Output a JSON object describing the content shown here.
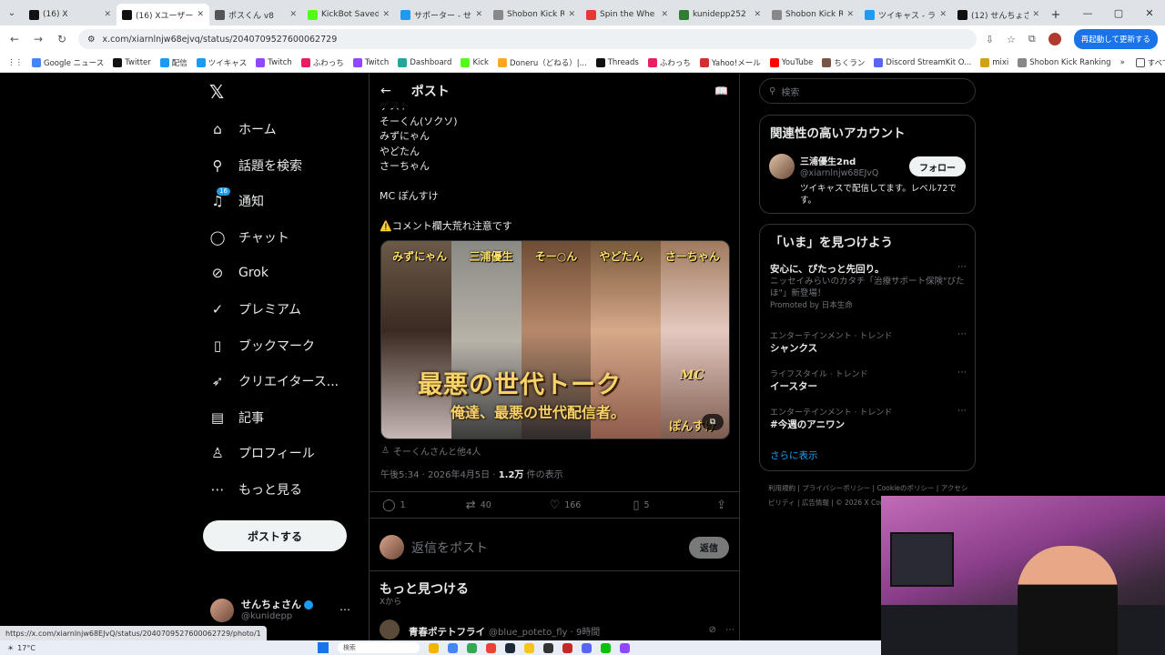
{
  "browser": {
    "tabs": [
      {
        "title": "(16) X",
        "fav_color": "#111111",
        "active": false
      },
      {
        "title": "(16) Xユーザーの",
        "fav_color": "#111111",
        "active": true
      },
      {
        "title": "ポスくん v8",
        "fav_color": "#555555",
        "active": false
      },
      {
        "title": "KickBot Saved",
        "fav_color": "#53fc18",
        "active": false
      },
      {
        "title": "サポーター - せん",
        "fav_color": "#1d9bf0",
        "active": false
      },
      {
        "title": "Shobon Kick R",
        "fav_color": "#888888",
        "active": false
      },
      {
        "title": "Spin the Whe",
        "fav_color": "#e53935",
        "active": false
      },
      {
        "title": "kunidepp252",
        "fav_color": "#2e7d32",
        "active": false
      },
      {
        "title": "Shobon Kick R",
        "fav_color": "#888888",
        "active": false
      },
      {
        "title": "ツイキャス - ライブ",
        "fav_color": "#1d9bf0",
        "active": false
      },
      {
        "title": "(12) せんちょさん",
        "fav_color": "#111111",
        "active": false
      }
    ],
    "url": "x.com/xiarnlnjw68ejvq/status/2040709527600062729",
    "restart_label": "再起動して更新する",
    "bookmarks": [
      {
        "label": "Google ニュース",
        "color": "#4285f4"
      },
      {
        "label": "Twitter",
        "color": "#111111"
      },
      {
        "label": "配信",
        "color": "#1d9bf0"
      },
      {
        "label": "ツイキャス",
        "color": "#1d9bf0"
      },
      {
        "label": "Twitch",
        "color": "#9146ff"
      },
      {
        "label": "ふわっち",
        "color": "#e91e63"
      },
      {
        "label": "Twitch",
        "color": "#9146ff"
      },
      {
        "label": "Dashboard",
        "color": "#26a69a"
      },
      {
        "label": "Kick",
        "color": "#53fc18"
      },
      {
        "label": "Doneru（どねる）|...",
        "color": "#f9a825"
      },
      {
        "label": "Threads",
        "color": "#111111"
      },
      {
        "label": "ふわっち",
        "color": "#e91e63"
      },
      {
        "label": "Yahoo!メール",
        "color": "#d32f2f"
      },
      {
        "label": "YouTube",
        "color": "#ff0000"
      },
      {
        "label": "ちくラン",
        "color": "#795548"
      },
      {
        "label": "Discord StreamKit O...",
        "color": "#5865f2"
      },
      {
        "label": "mixi",
        "color": "#d4a017"
      },
      {
        "label": "Shobon Kick Ranking",
        "color": "#888888"
      }
    ],
    "all_bookmarks": "すべてのブック",
    "status_url": "https://x.com/xiarnlnjw68EJvQ/status/2040709527600062729/photo/1"
  },
  "nav": {
    "items": [
      {
        "label": "ホーム",
        "icon": "home-icon",
        "glyph": "⌂"
      },
      {
        "label": "話題を検索",
        "icon": "search-icon",
        "glyph": "⚲"
      },
      {
        "label": "通知",
        "icon": "bell-icon",
        "glyph": "♫",
        "badge": "16"
      },
      {
        "label": "チャット",
        "icon": "chat-icon",
        "glyph": "◯"
      },
      {
        "label": "Grok",
        "icon": "grok-icon",
        "glyph": "⊘"
      },
      {
        "label": "プレミアム",
        "icon": "premium-icon",
        "glyph": "✓"
      },
      {
        "label": "ブックマーク",
        "icon": "bookmark-icon",
        "glyph": "▯"
      },
      {
        "label": "クリエイタース...",
        "icon": "rocket-icon",
        "glyph": "➶"
      },
      {
        "label": "記事",
        "icon": "article-icon",
        "glyph": "▤"
      },
      {
        "label": "プロフィール",
        "icon": "profile-icon",
        "glyph": "♙"
      },
      {
        "label": "もっと見る",
        "icon": "more-icon",
        "glyph": "⋯"
      }
    ],
    "post_button": "ポストする",
    "account_name": "せんちょさん",
    "account_handle": "@kunidepp"
  },
  "main": {
    "header_title": "ポスト",
    "text_lines": [
      "ゲスト",
      "そーくん(ソクソ)",
      "みずにゃん",
      "やどたん",
      "さーちゃん",
      "",
      "MC ぽんすけ",
      "",
      "⚠️コメント欄大荒れ注意です"
    ],
    "media": {
      "names": [
        "みずにゃん",
        "三浦優生",
        "そー○ん",
        "やどたん",
        "さーちゃん"
      ],
      "title": "最悪の世代トーク",
      "subtitle": "俺達、最悪の世代配信者。",
      "mc": "MC",
      "mc_name": "ぽんすけ"
    },
    "tagged": "そーくんさんと他4人",
    "time": "午後5:34 · 2026年4月5日 · ",
    "views_count": "1.2万",
    "views_label": " 件の表示",
    "actions": {
      "replies": "1",
      "reposts": "40",
      "likes": "166",
      "bookmarks": "5"
    },
    "reply_placeholder": "返信をポスト",
    "reply_button": "返信",
    "more_title": "もっと見つける",
    "more_sub": "Xから",
    "more_post": {
      "name": "青春ポテトフライ",
      "handle": "@blue_poteto_fly · 9時間"
    }
  },
  "sidebar": {
    "search_placeholder": "検索",
    "related_title": "関連性の高いアカウント",
    "rec": {
      "name": "三浦優生2nd",
      "handle": "@xiarnlnjw68EJvQ",
      "follow": "フォロー",
      "bio": "ツイキャスで配信してます。レベル72です。"
    },
    "trends_title": "「いま」を見つけよう",
    "promo": {
      "title": "安心に、ぴたっと先回り。",
      "desc": "ニッセイみらいのカタチ「治療サポート保険\"ぴたほ\"」新登場！",
      "promoted": "Promoted by 日本生命"
    },
    "trends": [
      {
        "category": "エンターテインメント · トレンド",
        "name": "シャンクス"
      },
      {
        "category": "ライフスタイル · トレンド",
        "name": "イースター"
      },
      {
        "category": "エンターテインメント · トレンド",
        "name": "#今週のアニワン"
      }
    ],
    "show_more": "さらに表示",
    "footer": [
      "利用規約",
      "プライバシーポリシー",
      "Cookieのポリシー",
      "アクセシビリティ",
      "広告情報",
      "© 2026 X Corp."
    ]
  },
  "taskbar": {
    "temp": "17°C",
    "search_label": "検索"
  }
}
